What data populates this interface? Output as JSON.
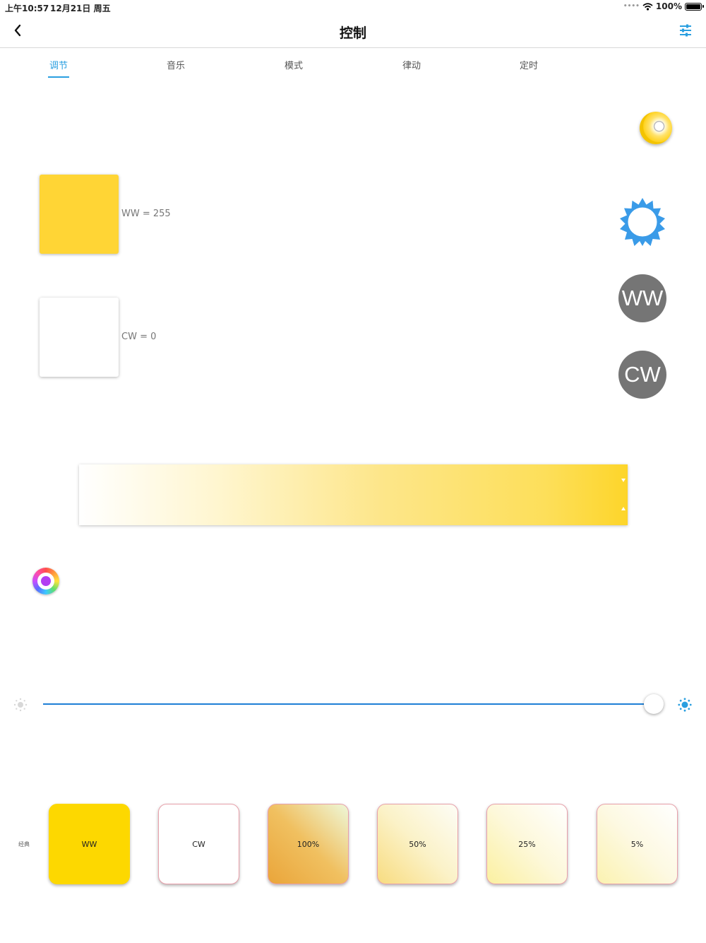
{
  "status_bar": {
    "time": "上午10:57",
    "date": "12月21日 周五",
    "signal": "••••",
    "battery": "100%"
  },
  "nav": {
    "title": "控制",
    "back_icon": "chevron-left-icon",
    "settings_icon": "sliders-icon"
  },
  "tabs": [
    {
      "label": "调节",
      "active": true
    },
    {
      "label": "音乐",
      "active": false
    },
    {
      "label": "模式",
      "active": false
    },
    {
      "label": "律动",
      "active": false
    },
    {
      "label": "定时",
      "active": false
    }
  ],
  "channels": [
    {
      "label": "WW = 255",
      "color": "#ffd535"
    },
    {
      "label": "CW = 0",
      "color": "#ffffff"
    }
  ],
  "buttons": {
    "ww": "WW",
    "cw": "CW"
  },
  "colors": {
    "accent": "#2a9fe0",
    "slider": "#1e7fd6",
    "round_button": "#757575",
    "sun": "#3a9be8"
  },
  "brightness": {
    "value_fraction": 0.99
  },
  "presets": {
    "label": "经典",
    "items": [
      {
        "label": "WW",
        "background": "#fdd800"
      },
      {
        "label": "CW",
        "background": "#ffffff"
      },
      {
        "label": "100%",
        "background": "linear-gradient(45deg, #eaa53a 0%, #f0c060 50%, #eef7d8 100%)"
      },
      {
        "label": "50%",
        "background": "linear-gradient(45deg, #f8dc80 0%, #fbf2c8 50%, #fdfdf6 100%)"
      },
      {
        "label": "25%",
        "background": "linear-gradient(45deg, #fbf0a0 0%, #fdf8da 50%, #ffffff 100%)"
      },
      {
        "label": "5%",
        "background": "linear-gradient(45deg, #fbf2b0 0%, #fdf9e2 50%, #ffffff 100%)"
      }
    ]
  }
}
